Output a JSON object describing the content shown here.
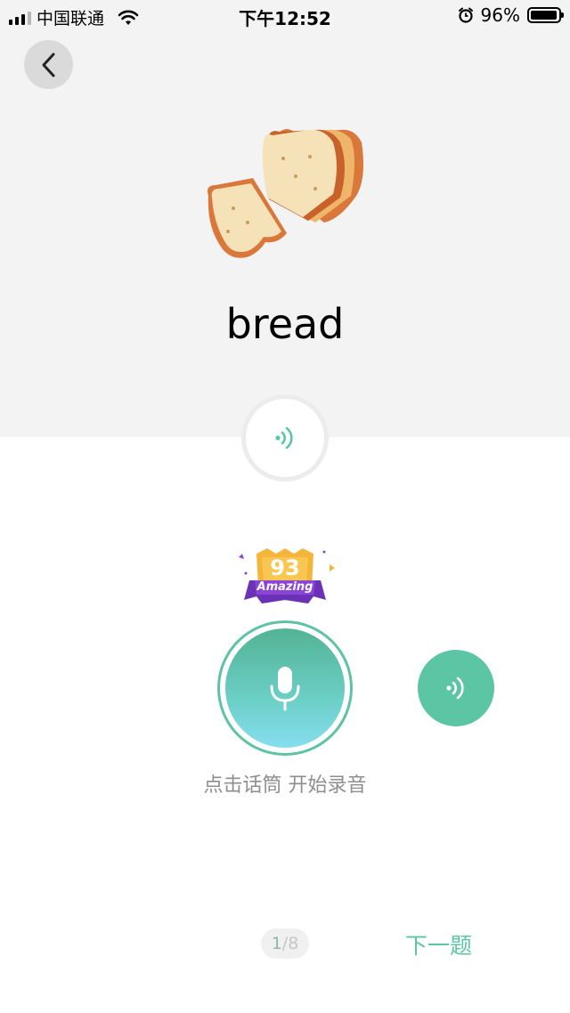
{
  "status_bar": {
    "carrier": "中国联通",
    "time": "下午12:52",
    "battery": "96%"
  },
  "icons": {
    "back": "chevron-left-icon",
    "speaker": "speaker-wave-icon",
    "mic": "microphone-icon",
    "image": "bread-image"
  },
  "lesson": {
    "word": "bread"
  },
  "score": {
    "value": "93",
    "label": "Amazing"
  },
  "record": {
    "hint": "点击话筒 开始录音"
  },
  "pagination": {
    "current": "1",
    "separator": "/",
    "total": "8"
  },
  "actions": {
    "next_label": "下一题"
  },
  "colors": {
    "accent": "#5cc6a4",
    "top_bg": "#f3f3f3"
  }
}
